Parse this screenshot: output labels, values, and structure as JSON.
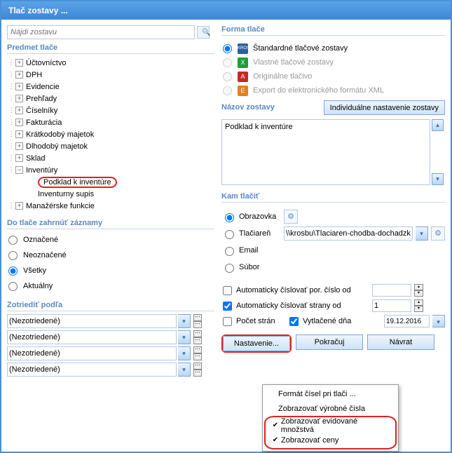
{
  "title": "Tlač zostavy ...",
  "search": {
    "placeholder": "Nájdi zostavu"
  },
  "sections": {
    "predmet": "Predmet tlače",
    "forma": "Forma tlače",
    "nazov": "Názov zostavy",
    "kam": "Kam tlačiť",
    "records": "Do tlače zahrnúť záznamy",
    "sort": "Zotriediť podľa"
  },
  "tree": {
    "items": [
      "Účtovníctvo",
      "DPH",
      "Evidencie",
      "Prehľady",
      "Číselníky",
      "Fakturácia",
      "Krátkodobý majetok",
      "Dlhodobý majetok",
      "Sklad"
    ],
    "expanded": "Inventúry",
    "children": [
      "Podklad k inventúre",
      "Inventurny supis"
    ],
    "last": "Manažérske funkcie"
  },
  "records": {
    "opts": [
      "Označené",
      "Neoznačené",
      "Všetky",
      "Aktuálny"
    ]
  },
  "sort": {
    "value": "(Nezotriedené)"
  },
  "forma": {
    "opts": [
      "Štandardné tlačové zostavy",
      "Vlastné tlačové zostavy",
      "Originálne tlačivo",
      "Export do elektronického formátu XML"
    ],
    "iconLabels": [
      "KROS",
      "X",
      "A",
      "E"
    ]
  },
  "nazov": {
    "btn": "Individuálne nastavenie zostavy",
    "value": "Podklad k inventúre"
  },
  "kam": {
    "opts": [
      "Obrazovka",
      "Tlačiareň",
      "Email",
      "Súbor"
    ],
    "printer": "\\\\krosbu\\Tlaciaren-chodba-dochadzk..."
  },
  "opts": {
    "autoPor": "Automaticky číslovať por. číslo od",
    "autoStr": "Automaticky číslovať strany od",
    "pocet": "Počet strán",
    "vytlacene": "Vytlačené dňa",
    "pageFrom": "1",
    "date": "19.12.2016"
  },
  "buttons": {
    "nastavenie": "Nastavenie...",
    "pokracuj": "Pokračuj",
    "navrat": "Návrat"
  },
  "menu": {
    "items": [
      "Formát čísel pri tlači ...",
      "Zobrazovať výrobné čísla",
      "Zobrazovať evidované množstvá",
      "Zobrazovať ceny"
    ]
  }
}
